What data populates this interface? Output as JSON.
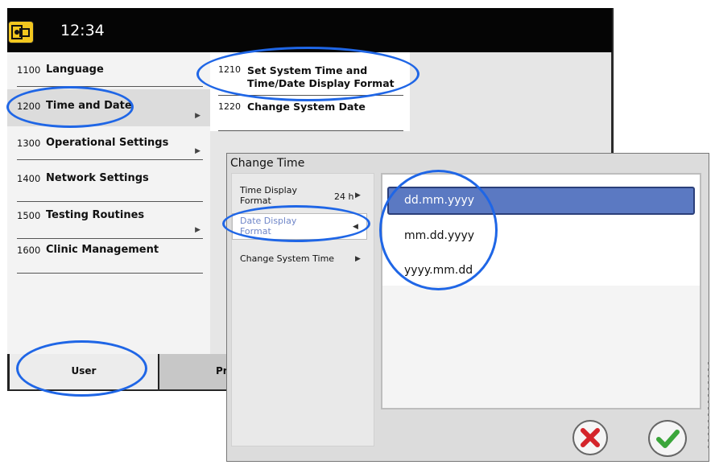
{
  "header": {
    "time": "12:34"
  },
  "menu": [
    {
      "num": "1100",
      "label": "Language"
    },
    {
      "num": "1200",
      "label": "Time and Date"
    },
    {
      "num": "1300",
      "label": "Operational Settings"
    },
    {
      "num": "1400",
      "label": "Network Settings"
    },
    {
      "num": "1500",
      "label": "Testing Routines"
    },
    {
      "num": "1600",
      "label": "Clinic Management"
    }
  ],
  "submenu": [
    {
      "num": "1210",
      "label": "Set System Time and Time/Date Display Format"
    },
    {
      "num": "1220",
      "label": "Change System Date"
    }
  ],
  "bottom_tabs": {
    "user": "User",
    "pr": "Pr"
  },
  "dialog": {
    "title": "Change Time",
    "options": [
      {
        "label": "Time Display Format",
        "value": "24 h"
      },
      {
        "label": "Date Display Format",
        "value": ""
      },
      {
        "label": "Change System Time",
        "value": ""
      }
    ],
    "formats": [
      "dd.mm.yyyy",
      "mm.dd.yyyy",
      "yyyy.mm.dd"
    ],
    "selected_format": "dd.mm.yyyy"
  },
  "colors": {
    "highlight_ring": "#1f66e6",
    "selected_item": "#5b79c2",
    "cancel": "#d4242a",
    "ok": "#3aa63a"
  },
  "icons": {
    "logo": "device-logo-icon",
    "cancel": "x-icon",
    "ok": "check-icon"
  }
}
